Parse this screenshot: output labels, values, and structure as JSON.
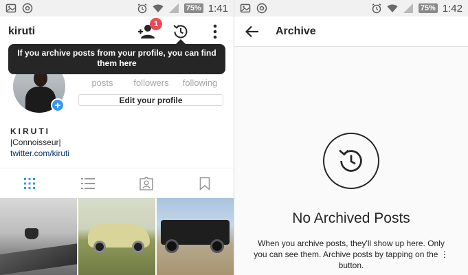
{
  "left": {
    "status_bar": {
      "battery": "75%",
      "time": "1:41"
    },
    "header": {
      "username": "kiruti",
      "notification_count": "1"
    },
    "tooltip": "If you archive posts from your profile, you can find them here",
    "stats": {
      "posts_label": "posts",
      "followers_label": "followers",
      "following_label": "following"
    },
    "edit_profile_label": "Edit your profile",
    "bio": {
      "name": "KIRUTI",
      "tagline": "|Connoisseur|",
      "link": "twitter.com/kiruti"
    },
    "tabs": [
      {
        "icon": "grid-view-icon"
      },
      {
        "icon": "list-view-icon"
      },
      {
        "icon": "tagged-photos-icon"
      },
      {
        "icon": "saved-bookmark-icon"
      }
    ]
  },
  "right": {
    "status_bar": {
      "battery": "75%",
      "time": "1:42"
    },
    "header": {
      "title": "Archive"
    },
    "empty": {
      "title": "No Archived Posts",
      "description": "When you archive posts, they'll show up here. Only you can see them. Archive posts by tapping on the ⋮ button."
    }
  },
  "colors": {
    "accent_blue": "#3897f0",
    "badge_red": "#ed4956",
    "link_blue": "#003569",
    "tooltip_bg": "#262626"
  }
}
